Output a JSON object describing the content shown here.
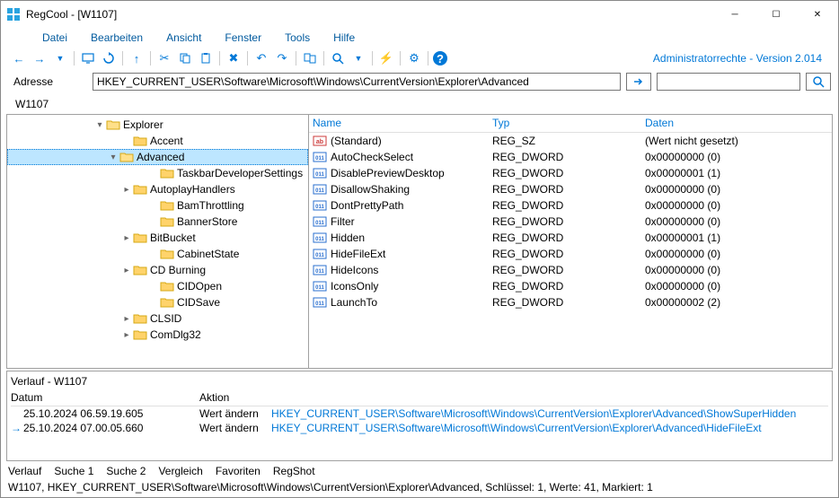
{
  "window": {
    "title": "RegCool - [W1107]"
  },
  "menu": {
    "items": [
      "Datei",
      "Bearbeiten",
      "Ansicht",
      "Fenster",
      "Tools",
      "Hilfe"
    ]
  },
  "admin": {
    "text": "Administratorrechte - Version 2.014"
  },
  "address": {
    "label": "Adresse",
    "value": "HKEY_CURRENT_USER\\Software\\Microsoft\\Windows\\CurrentVersion\\Explorer\\Advanced"
  },
  "doctab": {
    "label": "W1107"
  },
  "tree": {
    "items": [
      {
        "indent": 96,
        "exp": "▾",
        "open": true,
        "label": "Explorer",
        "selected": false
      },
      {
        "indent": 126,
        "exp": "",
        "open": false,
        "label": "Accent",
        "selected": false
      },
      {
        "indent": 110,
        "exp": "▾",
        "open": true,
        "label": "Advanced",
        "selected": true
      },
      {
        "indent": 156,
        "exp": "",
        "open": false,
        "label": "TaskbarDeveloperSettings",
        "selected": false
      },
      {
        "indent": 126,
        "exp": "▸",
        "open": false,
        "label": "AutoplayHandlers",
        "selected": false
      },
      {
        "indent": 156,
        "exp": "",
        "open": false,
        "label": "BamThrottling",
        "selected": false
      },
      {
        "indent": 156,
        "exp": "",
        "open": false,
        "label": "BannerStore",
        "selected": false
      },
      {
        "indent": 126,
        "exp": "▸",
        "open": false,
        "label": "BitBucket",
        "selected": false
      },
      {
        "indent": 156,
        "exp": "",
        "open": false,
        "label": "CabinetState",
        "selected": false
      },
      {
        "indent": 126,
        "exp": "▸",
        "open": false,
        "label": "CD Burning",
        "selected": false
      },
      {
        "indent": 156,
        "exp": "",
        "open": false,
        "label": "CIDOpen",
        "selected": false
      },
      {
        "indent": 156,
        "exp": "",
        "open": false,
        "label": "CIDSave",
        "selected": false
      },
      {
        "indent": 126,
        "exp": "▸",
        "open": false,
        "label": "CLSID",
        "selected": false
      },
      {
        "indent": 126,
        "exp": "▸",
        "open": false,
        "label": "ComDlg32",
        "selected": false
      }
    ]
  },
  "list": {
    "headers": {
      "name": "Name",
      "type": "Typ",
      "data": "Daten"
    },
    "rows": [
      {
        "icon": "str",
        "name": "(Standard)",
        "type": "REG_SZ",
        "data": "(Wert nicht gesetzt)"
      },
      {
        "icon": "dw",
        "name": "AutoCheckSelect",
        "type": "REG_DWORD",
        "data": "0x00000000 (0)"
      },
      {
        "icon": "dw",
        "name": "DisablePreviewDesktop",
        "type": "REG_DWORD",
        "data": "0x00000001 (1)"
      },
      {
        "icon": "dw",
        "name": "DisallowShaking",
        "type": "REG_DWORD",
        "data": "0x00000000 (0)"
      },
      {
        "icon": "dw",
        "name": "DontPrettyPath",
        "type": "REG_DWORD",
        "data": "0x00000000 (0)"
      },
      {
        "icon": "dw",
        "name": "Filter",
        "type": "REG_DWORD",
        "data": "0x00000000 (0)"
      },
      {
        "icon": "dw",
        "name": "Hidden",
        "type": "REG_DWORD",
        "data": "0x00000001 (1)"
      },
      {
        "icon": "dw",
        "name": "HideFileExt",
        "type": "REG_DWORD",
        "data": "0x00000000 (0)"
      },
      {
        "icon": "dw",
        "name": "HideIcons",
        "type": "REG_DWORD",
        "data": "0x00000000 (0)"
      },
      {
        "icon": "dw",
        "name": "IconsOnly",
        "type": "REG_DWORD",
        "data": "0x00000000 (0)"
      },
      {
        "icon": "dw",
        "name": "LaunchTo",
        "type": "REG_DWORD",
        "data": "0x00000002 (2)"
      }
    ]
  },
  "history": {
    "title": "Verlauf - W1107",
    "headers": {
      "datum": "Datum",
      "aktion": "Aktion"
    },
    "rows": [
      {
        "current": false,
        "time": "25.10.2024 06.59.19.605",
        "action": "Wert ändern",
        "path": "HKEY_CURRENT_USER\\Software\\Microsoft\\Windows\\CurrentVersion\\Explorer\\Advanced\\ShowSuperHidden"
      },
      {
        "current": true,
        "time": "25.10.2024 07.00.05.660",
        "action": "Wert ändern",
        "path": "HKEY_CURRENT_USER\\Software\\Microsoft\\Windows\\CurrentVersion\\Explorer\\Advanced\\HideFileExt"
      }
    ]
  },
  "bottomtabs": {
    "items": [
      "Verlauf",
      "Suche 1",
      "Suche 2",
      "Vergleich",
      "Favoriten",
      "RegShot"
    ]
  },
  "status": {
    "text": "W1107, HKEY_CURRENT_USER\\Software\\Microsoft\\Windows\\CurrentVersion\\Explorer\\Advanced, Schlüssel: 1, Werte: 41, Markiert: 1"
  }
}
